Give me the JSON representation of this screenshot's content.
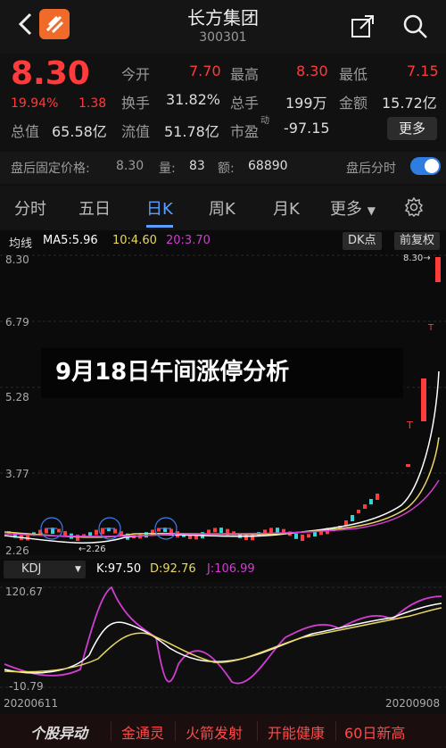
{
  "header": {
    "title": "长方集团",
    "code": "300301"
  },
  "quote": {
    "price": "8.30",
    "pct": "19.94%",
    "chg": "1.38",
    "open_label": "今开",
    "open": "7.70",
    "high_label": "最高",
    "high": "8.30",
    "low_label": "最低",
    "low": "7.15",
    "turnover_label": "换手",
    "turnover": "31.82%",
    "volume_label": "总手",
    "volume": "199万",
    "amount_label": "金额",
    "amount": "15.72亿",
    "mcap_label": "总值",
    "mcap": "65.58亿",
    "float_label": "流值",
    "float": "51.78亿",
    "pe_label": "市盈",
    "pe_mark": "动",
    "pe": "-97.15",
    "more": "更多"
  },
  "after_hours": {
    "price_label": "盘后固定价格:",
    "price": "8.30",
    "vol_label": "量:",
    "vol": "83",
    "amount_label": "额:",
    "amount": "68890",
    "minute_label": "盘后分时",
    "toggle_on": true
  },
  "tabs": [
    {
      "label": "分时"
    },
    {
      "label": "五日"
    },
    {
      "label": "日K"
    },
    {
      "label": "周K"
    },
    {
      "label": "月K"
    },
    {
      "label": "更多"
    }
  ],
  "active_tab": "日K",
  "chart": {
    "ma_label": "均线",
    "ma5": "MA5:5.96",
    "ma10": "10:4.60",
    "ma20": "20:3.70",
    "dk_button": "DK点",
    "fq_button": "前复权",
    "y_ticks": [
      "8.30",
      "6.79",
      "5.28",
      "3.77",
      "2.26"
    ],
    "max_label": "8.30",
    "min_label": "2.26"
  },
  "banner": "9月18日午间涨停分析",
  "kdj": {
    "name": "KDJ",
    "k": "K:97.50",
    "d": "D:92.76",
    "j": "J:106.99",
    "top": "120.67",
    "bottom": "-10.79",
    "start_date": "20200611",
    "end_date": "20200908"
  },
  "bottom_bar": {
    "logo": "个股异动",
    "items": [
      "金通灵",
      "火箭发射",
      "开能健康",
      "60日新高"
    ]
  },
  "colors": {
    "up": "#ff3b3b",
    "accent": "#5aa0ff",
    "ma5": "#ffffff",
    "ma10": "#e8d860",
    "ma20": "#d23cd2"
  }
}
